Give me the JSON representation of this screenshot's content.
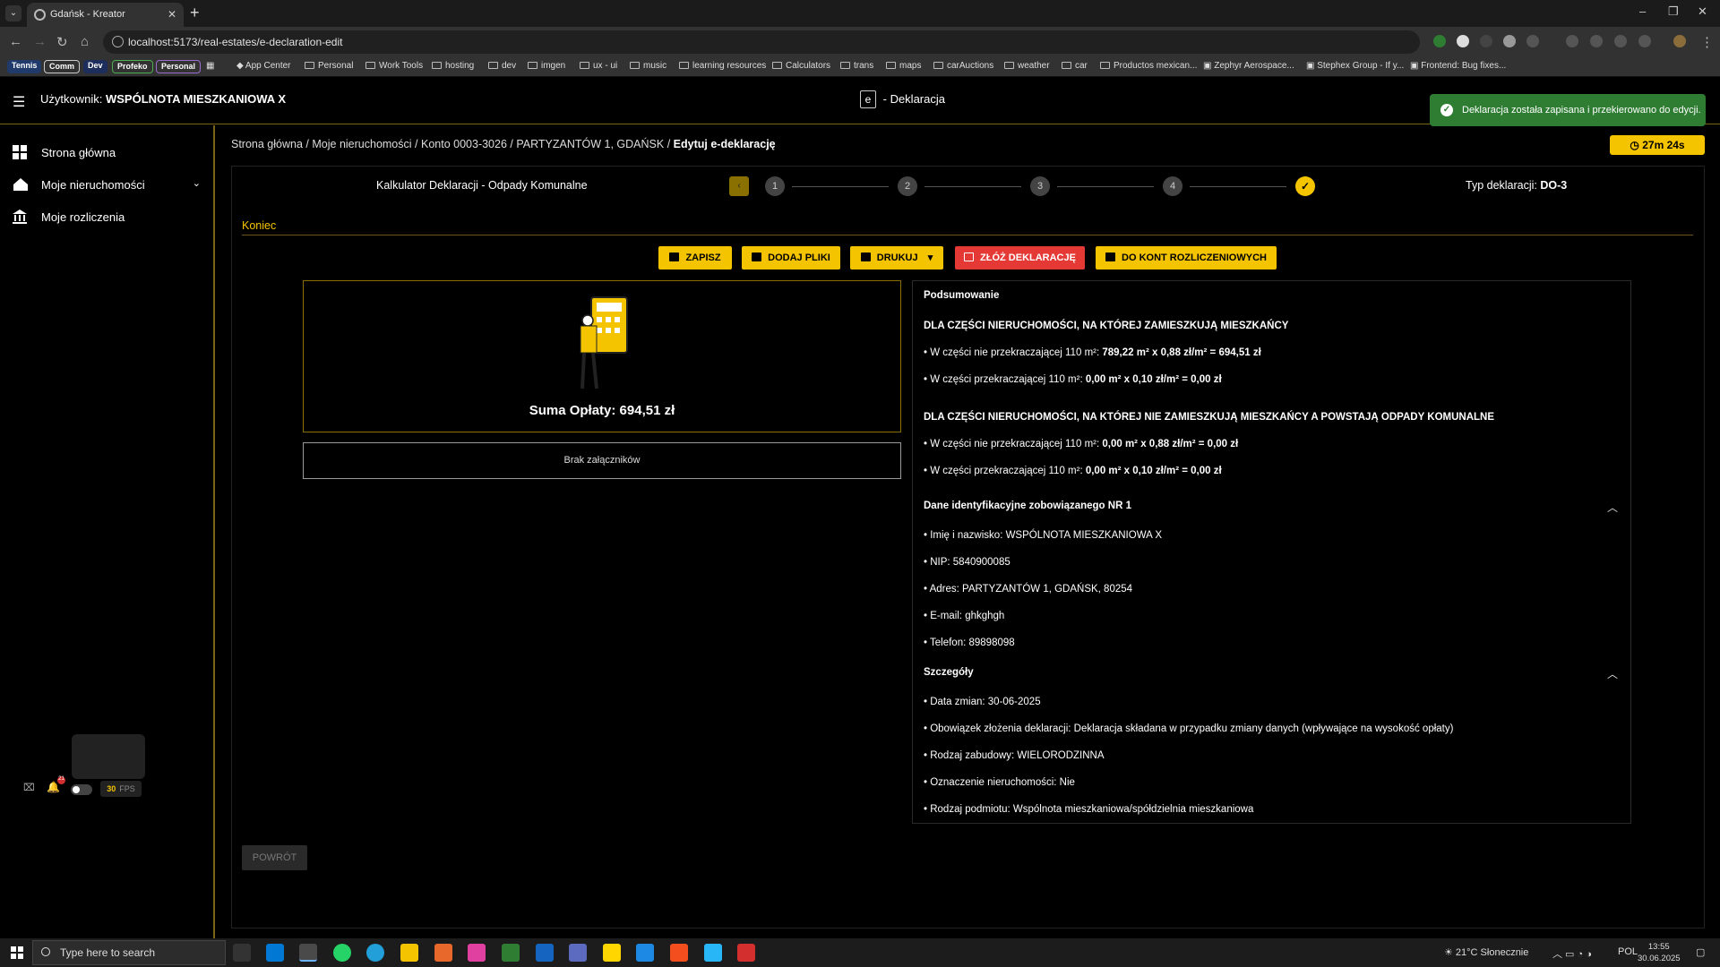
{
  "browser": {
    "tab_title": "Gdańsk - Kreator",
    "url": "localhost:5173/real-estates/e-declaration-edit",
    "bookmark_pills": [
      "Tennis",
      "Comm",
      "Dev",
      "Profeko",
      "Personal"
    ],
    "bookmarks": [
      "App Center",
      "Personal",
      "Work Tools",
      "hosting",
      "dev",
      "imgen",
      "ux - ui",
      "music",
      "learning resources",
      "Calculators",
      "trans",
      "maps",
      "carAuctions",
      "weather",
      "car",
      "Productos mexican...",
      "Zephyr Aerospace...",
      "Stephex Group - If y...",
      "Frontend: Bug fixes..."
    ]
  },
  "header": {
    "user_prefix": "Użytkownik:",
    "user_name": "WSPÓLNOTA MIESZKANIOWA X",
    "brand_letter": "e",
    "brand_text": "- Deklaracja",
    "toast": "Deklaracja została zapisana i przekierowano do edycji."
  },
  "sidebar": {
    "items": [
      {
        "label": "Strona główna",
        "icon": "dashboard-icon"
      },
      {
        "label": "Moje nieruchomości",
        "icon": "home-icon"
      },
      {
        "label": "Moje rozliczenia",
        "icon": "bank-icon"
      }
    ],
    "notification_count": "21",
    "fps_value": "30",
    "fps_label": "FPS"
  },
  "timer": "27m 24s",
  "breadcrumb": {
    "items": [
      "Strona główna",
      "Moje nieruchomości",
      "Konto 0003-3026",
      "PARTYZANTÓW 1, GDAŃSK"
    ],
    "current": "Edytuj e-deklarację",
    "separator": "/"
  },
  "wizard": {
    "title": "Kalkulator Deklaracji - Odpady Komunalne",
    "back_label": "‹",
    "steps": [
      "1",
      "2",
      "3",
      "4"
    ],
    "declaration_type_label": "Typ deklaracji:",
    "declaration_type_value": "DO-3",
    "section": "Koniec"
  },
  "actions": {
    "save": "ZAPISZ",
    "add_files": "DODAJ PLIKI",
    "print": "DRUKUJ",
    "submit": "ZŁÓŻ DEKLARACJĘ",
    "accounts": "DO KONT ROZLICZENIOWYCH"
  },
  "sum": {
    "label": "Suma Opłaty: 694,51 zł"
  },
  "attachments": "Brak załączników",
  "summary": {
    "title": "Podsumowanie",
    "section1": {
      "heading": "DLA CZĘŚCI NIERUCHOMOŚCI, NA KTÓREJ ZAMIESZKUJĄ MIESZKAŃCY",
      "line1_label": "• W części nie przekraczającej 110 m²: ",
      "line1_value": "789,22 m² x 0,88 zł/m² = 694,51 zł",
      "line2_label": "• W części przekraczającej 110 m²: ",
      "line2_value": "0,00 m² x 0,10 zł/m² = 0,00 zł"
    },
    "section2": {
      "heading": "DLA CZĘŚCI NIERUCHOMOŚCI, NA KTÓREJ NIE ZAMIESZKUJĄ MIESZKAŃCY A POWSTAJĄ ODPADY KOMUNALNE",
      "line1_label": "• W części nie przekraczającej 110 m²: ",
      "line1_value": "0,00 m² x 0,88 zł/m² = 0,00 zł",
      "line2_label": "• W części przekraczającej 110 m²: ",
      "line2_value": "0,00 m² x 0,10 zł/m² = 0,00 zł"
    },
    "identity": {
      "heading": "Dane identyfikacyjne zobowiązanego NR 1",
      "lines": [
        "• Imię i nazwisko: WSPÓLNOTA MIESZKANIOWA X",
        "• NIP: 5840900085",
        "• Adres: PARTYZANTÓW 1, GDAŃSK, 80254",
        "• E-mail: ghkghgh",
        "• Telefon: 89898098"
      ]
    },
    "details": {
      "heading": "Szczegóły",
      "lines": [
        "• Data zmian: 30-06-2025",
        "• Obowiązek złożenia deklaracji: Deklaracja składana w przypadku zmiany danych (wpływające na wysokość opłaty)",
        "• Rodzaj zabudowy: WIELORODZINNA",
        "• Oznaczenie nieruchomości: Nie",
        "• Rodzaj podmiotu: Wspólnota mieszkaniowa/spółdzielnia mieszkaniowa"
      ]
    }
  },
  "back_button": "POWRÓT",
  "taskbar": {
    "search_placeholder": "Type here to search",
    "weather": "21°C Słonecznie",
    "lang": "POL",
    "time": "13:55",
    "date": "30.06.2025"
  },
  "colors": {
    "accent": "#f5c400",
    "danger": "#e53935",
    "success": "#2e7d32"
  }
}
